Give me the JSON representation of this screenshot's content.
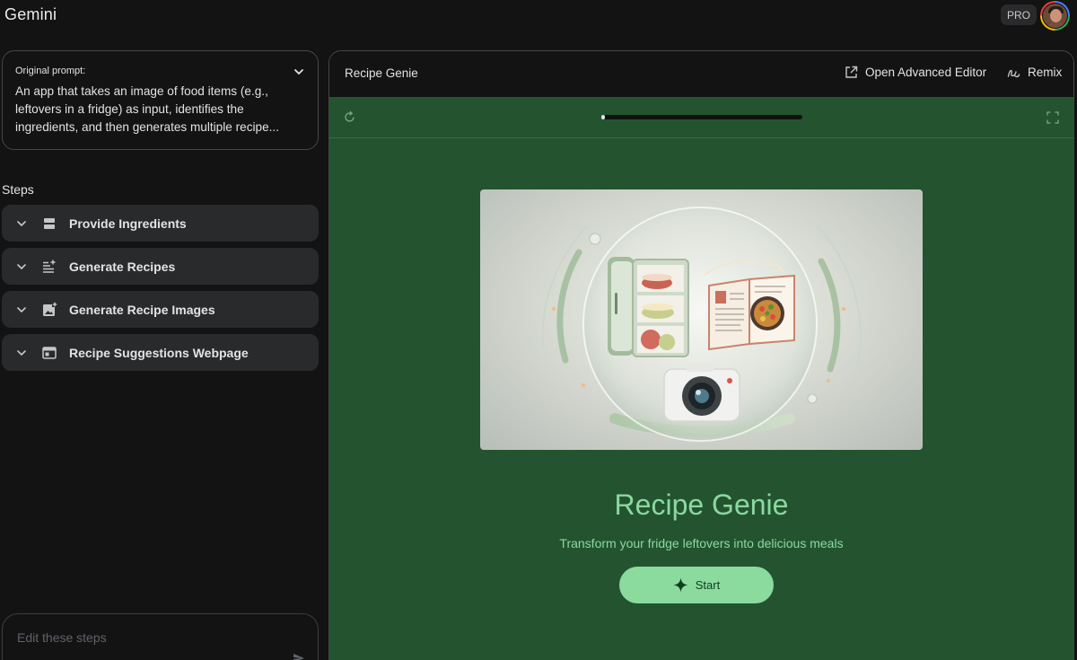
{
  "app": {
    "title": "Gemini",
    "badge": "PRO"
  },
  "prompt": {
    "label": "Original prompt:",
    "text": "An app that takes an image of food items (e.g., leftovers in a fridge) as input, identifies the ingredients, and then generates multiple recipe..."
  },
  "steps": {
    "heading": "Steps",
    "items": [
      {
        "label": "Provide Ingredients",
        "icon": "ingredients-icon"
      },
      {
        "label": "Generate Recipes",
        "icon": "list-sparkle-icon"
      },
      {
        "label": "Generate Recipe Images",
        "icon": "image-add-icon"
      },
      {
        "label": "Recipe Suggestions Webpage",
        "icon": "web-page-icon"
      }
    ]
  },
  "edit": {
    "placeholder": "Edit these steps"
  },
  "preview": {
    "title": "Recipe Genie",
    "open_editor": "Open Advanced Editor",
    "remix": "Remix",
    "load_progress": 0.02
  },
  "app_preview": {
    "title": "Recipe Genie",
    "subtitle": "Transform your fridge leftovers into delicious meals",
    "start_label": "Start"
  },
  "colors": {
    "preview_bg": "#23542f",
    "accent": "#8bd8a0",
    "button_bg": "#8bdb9f",
    "step_bg": "#282a2c"
  }
}
